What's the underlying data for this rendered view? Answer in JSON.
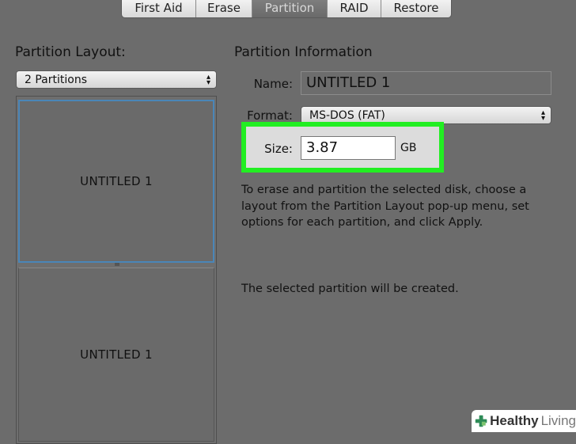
{
  "tabs": [
    {
      "label": "First Aid",
      "active": false
    },
    {
      "label": "Erase",
      "active": false
    },
    {
      "label": "Partition",
      "active": true
    },
    {
      "label": "RAID",
      "active": false
    },
    {
      "label": "Restore",
      "active": false
    }
  ],
  "layout": {
    "title": "Partition Layout:",
    "popup_value": "2 Partitions",
    "partitions": [
      {
        "name": "UNTITLED 1",
        "selected": true
      },
      {
        "name": "UNTITLED 1",
        "selected": false
      }
    ]
  },
  "info": {
    "title": "Partition Information",
    "name_label": "Name:",
    "name_value": "UNTITLED 1",
    "format_label": "Format:",
    "format_value": "MS-DOS (FAT)",
    "size_label": "Size:",
    "size_value": "3.87",
    "size_unit": "GB",
    "help_text": "To erase and partition the selected disk, choose a layout from the Partition Layout pop-up menu, set options for each partition, and click Apply.",
    "status_text": "The selected partition will be created."
  },
  "watermark": {
    "word1": "Healthy",
    "word2": "Living",
    "brand_color": "#2e8b57"
  },
  "colors": {
    "highlight": "#22ee22",
    "selection_border": "#4a86b8",
    "active_tab": "#6a6a6a"
  }
}
